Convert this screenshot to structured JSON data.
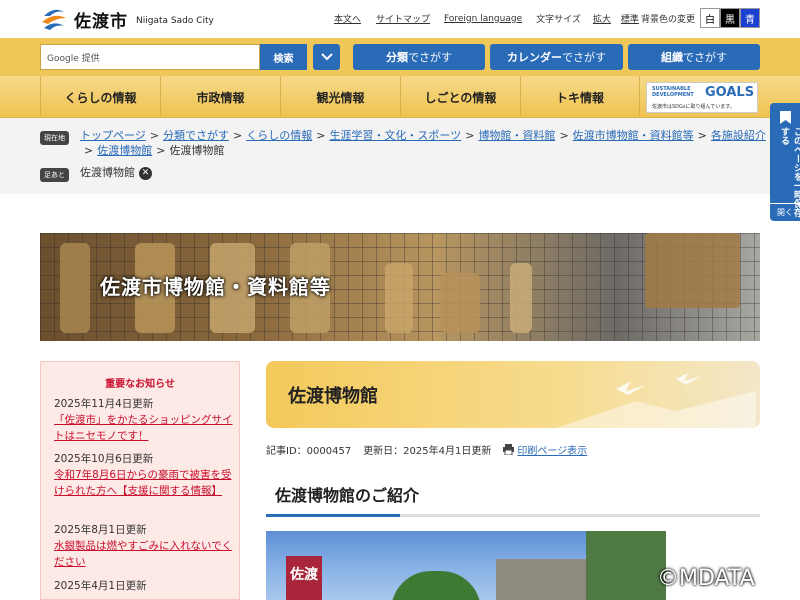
{
  "header": {
    "site_name": "佐渡市",
    "site_sub": "Niigata Sado City",
    "links": [
      "本文へ",
      "サイトマップ",
      "Foreign language"
    ],
    "fontsize_label": "文字サイズ",
    "fontsize_large": "拡大",
    "fontsize_standard": "標準",
    "bg_label": "背景色の変更",
    "bg_options": [
      "白",
      "黒",
      "青"
    ]
  },
  "search": {
    "placeholder": "Google 提供",
    "button": "検索",
    "category_bold": "分類",
    "category_rest": "でさがす",
    "calendar_bold": "カレンダー",
    "calendar_rest": "でさがす",
    "org_bold": "組織",
    "org_rest": "でさがす"
  },
  "nav": {
    "items": [
      "くらしの情報",
      "市政情報",
      "観光情報",
      "しごとの情報",
      "トキ情報"
    ],
    "sdgs_line1": "SUSTAINABLE",
    "sdgs_line1b": "DEVELOPMENT",
    "sdgs_goals": "GOALS",
    "sdgs_line2": "佐渡市はSDGsに取り組んでいます。"
  },
  "breadcrumb": {
    "current_tag": "現在地",
    "trail": [
      "トップページ",
      "分類でさがす",
      "くらしの情報",
      "生涯学習・文化・スポーツ",
      "博物館・資料館",
      "佐渡市博物館・資料館等",
      "各施設紹介",
      "佐渡博物館"
    ],
    "current": "佐渡博物館",
    "footprint_tag": "足あと",
    "footprint_item": "佐渡博物館"
  },
  "hero": {
    "title": "佐渡市博物館・資料館等"
  },
  "notice": {
    "title": "重要なお知らせ",
    "items": [
      {
        "date": "2025年11月4日更新",
        "text": "「佐渡市」をかたるショッピングサイトはニセモノです！"
      },
      {
        "date": "2025年10月6日更新",
        "text": "令和7年8月6日からの豪雨で被害を受けられた方へ【支援に関する情報】"
      },
      {
        "date": "2025年8月1日更新",
        "text": "水銀製品は燃やすごみに入れないでください"
      },
      {
        "date": "2025年4月1日更新",
        "text": ""
      }
    ]
  },
  "page": {
    "title": "佐渡博物館",
    "article_id": "記事ID：0000457",
    "updated": "更新日：2025年4月1日更新",
    "print": "印刷ページ表示",
    "section_title": "佐渡博物館のご紹介",
    "photo_sign": "佐渡"
  },
  "bookmark": {
    "label": "このページを一時保存する",
    "open": "開く"
  },
  "watermark": "©MDATA",
  "colors": {
    "accent_blue": "#2a6bb8",
    "nav_gold": "#f0c85a",
    "notice_red": "#c8102e"
  }
}
